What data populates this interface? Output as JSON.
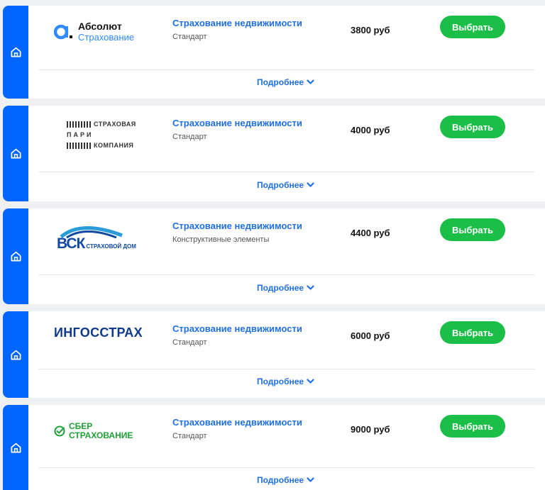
{
  "offers": [
    {
      "company_logo": {
        "line1": "Абсолют",
        "line2": "Страхование"
      },
      "title": "Страхование недвижимости",
      "plan": "Стандарт",
      "price": "3800 руб",
      "select_label": "Выбрать",
      "more_label": "Подробнее"
    },
    {
      "company_logo": {
        "line1": "СТРАХОВАЯ",
        "line2": "ПАРИ",
        "line3": "КОМПАНИЯ"
      },
      "title": "Страхование недвижимости",
      "plan": "Стандарт",
      "price": "4000 руб",
      "select_label": "Выбрать",
      "more_label": "Подробнее"
    },
    {
      "company_logo": {
        "line1": "ВСК",
        "line2": "СТРАХОВОЙ ДОМ"
      },
      "title": "Страхование недвижимости",
      "plan": "Конструктивные элементы",
      "price": "4400 руб",
      "select_label": "Выбрать",
      "more_label": "Подробнее"
    },
    {
      "company_logo": {
        "line1": "ИНГОССТРАХ"
      },
      "title": "Страхование недвижимости",
      "plan": "Стандарт",
      "price": "6000 руб",
      "select_label": "Выбрать",
      "more_label": "Подробнее"
    },
    {
      "company_logo": {
        "line1": "СБЕР",
        "line2": "СТРАХОВАНИЕ"
      },
      "title": "Страхование недвижимости",
      "plan": "Стандарт",
      "price": "9000 руб",
      "select_label": "Выбрать",
      "more_label": "Подробнее"
    }
  ],
  "icons": {
    "stripe": "house-icon",
    "expand": "chevron-down-icon"
  },
  "colors": {
    "accent": "#0066ff",
    "link": "#1f6fe5",
    "button": "#1bbf48"
  }
}
